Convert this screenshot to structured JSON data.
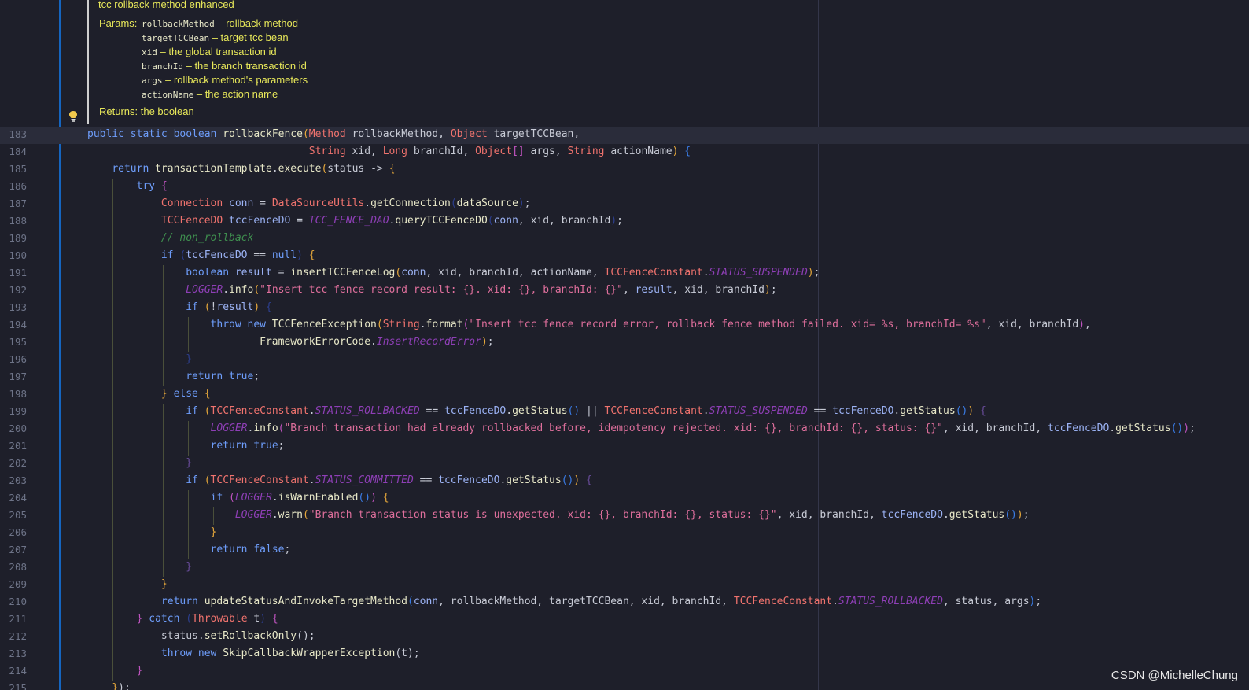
{
  "doc": {
    "summary": "tcc rollback method enhanced",
    "params_label": "Params:",
    "params": [
      {
        "name": "rollbackMethod",
        "desc": " – rollback method"
      },
      {
        "name": "targetTCCBean",
        "desc": " – target tcc bean"
      },
      {
        "name": "xid",
        "desc": " – the global transaction id"
      },
      {
        "name": "branchId",
        "desc": " – the branch transaction id"
      },
      {
        "name": "args",
        "desc": " – rollback method's parameters"
      },
      {
        "name": "actionName",
        "desc": " – the action name"
      }
    ],
    "returns": "Returns: the boolean"
  },
  "line_numbers": [
    "183",
    "184",
    "185",
    "186",
    "187",
    "188",
    "189",
    "190",
    "191",
    "192",
    "193",
    "194",
    "195",
    "196",
    "197",
    "198",
    "199",
    "200",
    "201",
    "202",
    "203",
    "204",
    "205",
    "206",
    "207",
    "208",
    "209",
    "210",
    "211",
    "212",
    "213",
    "214",
    "215"
  ],
  "watermark": "CSDN @MichelleChung"
}
